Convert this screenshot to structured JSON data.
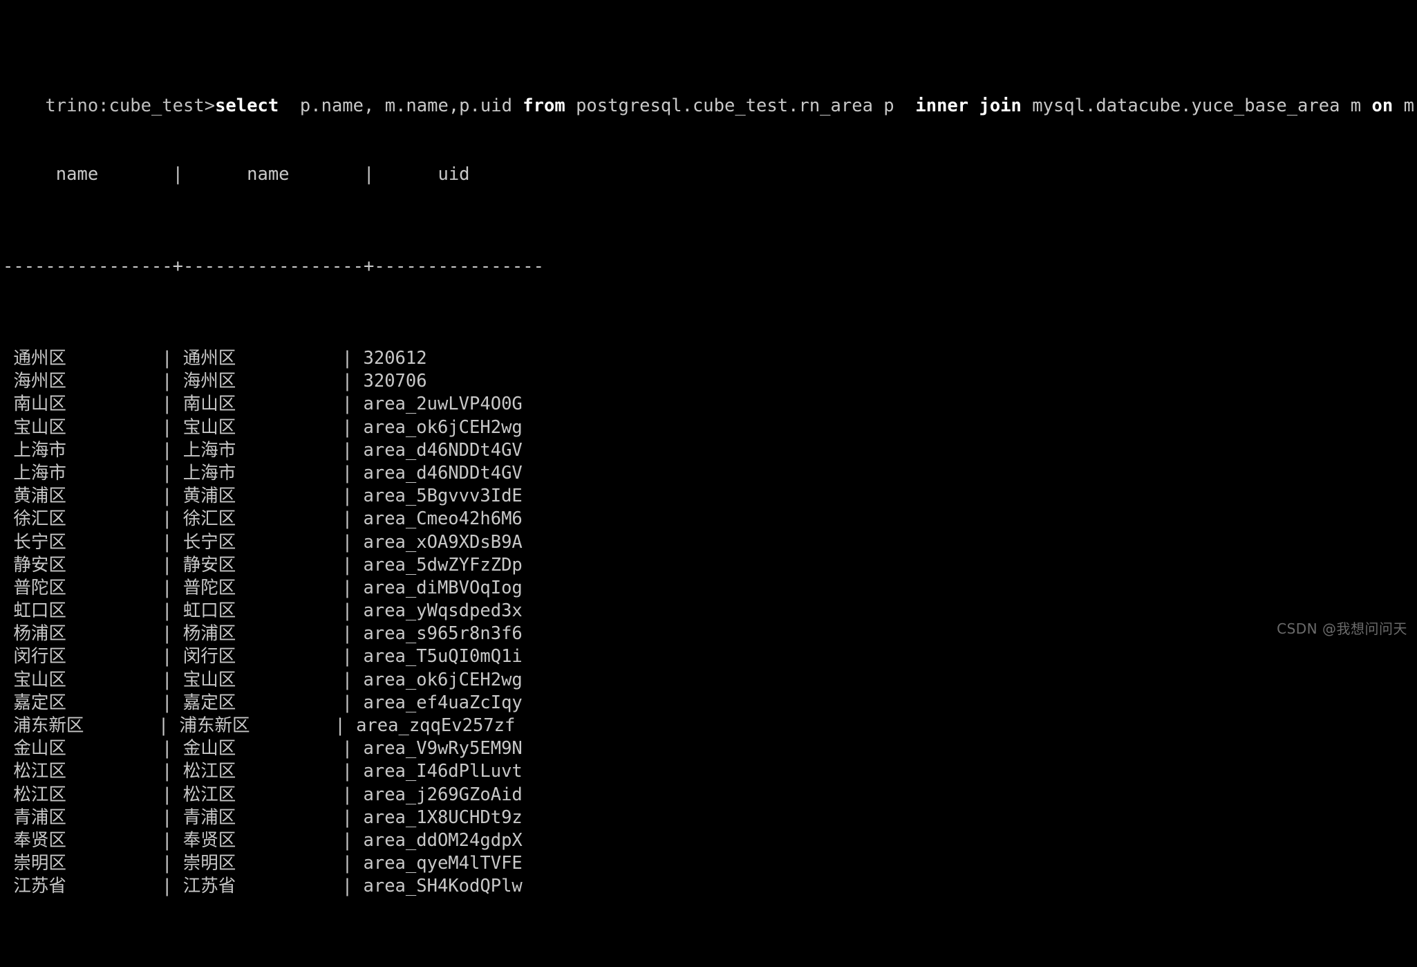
{
  "terminal": {
    "prompt": "trino:cube_test>",
    "query": {
      "full_text": "select  p.name, m.name,p.uid from postgresql.cube_test.rn_area p  inner join mysql.datacube.yuce_base_area m on m.name = p.name ;",
      "tokens": [
        {
          "text": "select",
          "bold": true
        },
        {
          "text": "  p.name, m.name,p.uid ",
          "bold": false
        },
        {
          "text": "from",
          "bold": true
        },
        {
          "text": " postgresql.cube_test.rn_area p  ",
          "bold": false
        },
        {
          "text": "inner join",
          "bold": true
        },
        {
          "text": " mysql.datacube.yuce_base_area m ",
          "bold": false
        },
        {
          "text": "on",
          "bold": true
        },
        {
          "text": " m.name = p.name ;",
          "bold": false
        }
      ]
    },
    "table": {
      "headers": [
        "name",
        "name",
        "uid"
      ],
      "header_line": "     name       |      name       |        uid",
      "separator_line": "----------------+-----------------+----------------",
      "column_separator": "|",
      "rows": [
        {
          "p_name": "通州区",
          "m_name": "通州区",
          "uid": "320612"
        },
        {
          "p_name": "海州区",
          "m_name": "海州区",
          "uid": "320706"
        },
        {
          "p_name": "南山区",
          "m_name": "南山区",
          "uid": "area_2uwLVP4O0G"
        },
        {
          "p_name": "宝山区",
          "m_name": "宝山区",
          "uid": "area_ok6jCEH2wg"
        },
        {
          "p_name": "上海市",
          "m_name": "上海市",
          "uid": "area_d46NDDt4GV"
        },
        {
          "p_name": "上海市",
          "m_name": "上海市",
          "uid": "area_d46NDDt4GV"
        },
        {
          "p_name": "黄浦区",
          "m_name": "黄浦区",
          "uid": "area_5Bgvvv3IdE"
        },
        {
          "p_name": "徐汇区",
          "m_name": "徐汇区",
          "uid": "area_Cmeo42h6M6"
        },
        {
          "p_name": "长宁区",
          "m_name": "长宁区",
          "uid": "area_xOA9XDsB9A"
        },
        {
          "p_name": "静安区",
          "m_name": "静安区",
          "uid": "area_5dwZYFzZDp"
        },
        {
          "p_name": "普陀区",
          "m_name": "普陀区",
          "uid": "area_diMBVOqIog"
        },
        {
          "p_name": "虹口区",
          "m_name": "虹口区",
          "uid": "area_yWqsdped3x"
        },
        {
          "p_name": "杨浦区",
          "m_name": "杨浦区",
          "uid": "area_s965r8n3f6"
        },
        {
          "p_name": "闵行区",
          "m_name": "闵行区",
          "uid": "area_T5uQI0mQ1i"
        },
        {
          "p_name": "宝山区",
          "m_name": "宝山区",
          "uid": "area_ok6jCEH2wg"
        },
        {
          "p_name": "嘉定区",
          "m_name": "嘉定区",
          "uid": "area_ef4uaZcIqy"
        },
        {
          "p_name": "浦东新区",
          "m_name": "浦东新区",
          "uid": "area_zqqEv257zf"
        },
        {
          "p_name": "金山区",
          "m_name": "金山区",
          "uid": "area_V9wRy5EM9N"
        },
        {
          "p_name": "松江区",
          "m_name": "松江区",
          "uid": "area_I46dPlLuvt"
        },
        {
          "p_name": "松江区",
          "m_name": "松江区",
          "uid": "area_j269GZoAid"
        },
        {
          "p_name": "青浦区",
          "m_name": "青浦区",
          "uid": "area_1X8UCHDt9z"
        },
        {
          "p_name": "奉贤区",
          "m_name": "奉贤区",
          "uid": "area_ddOM24gdpX"
        },
        {
          "p_name": "崇明区",
          "m_name": "崇明区",
          "uid": "area_qyeM4lTVFE"
        },
        {
          "p_name": "江苏省",
          "m_name": "江苏省",
          "uid": "area_SH4KodQPlw"
        }
      ]
    }
  },
  "watermark": {
    "text": "CSDN @我想问问天"
  },
  "colors": {
    "background": "#000000",
    "foreground": "#c8c8c8",
    "bold_keyword": "#ffffff",
    "watermark": "#6b6b6b"
  }
}
